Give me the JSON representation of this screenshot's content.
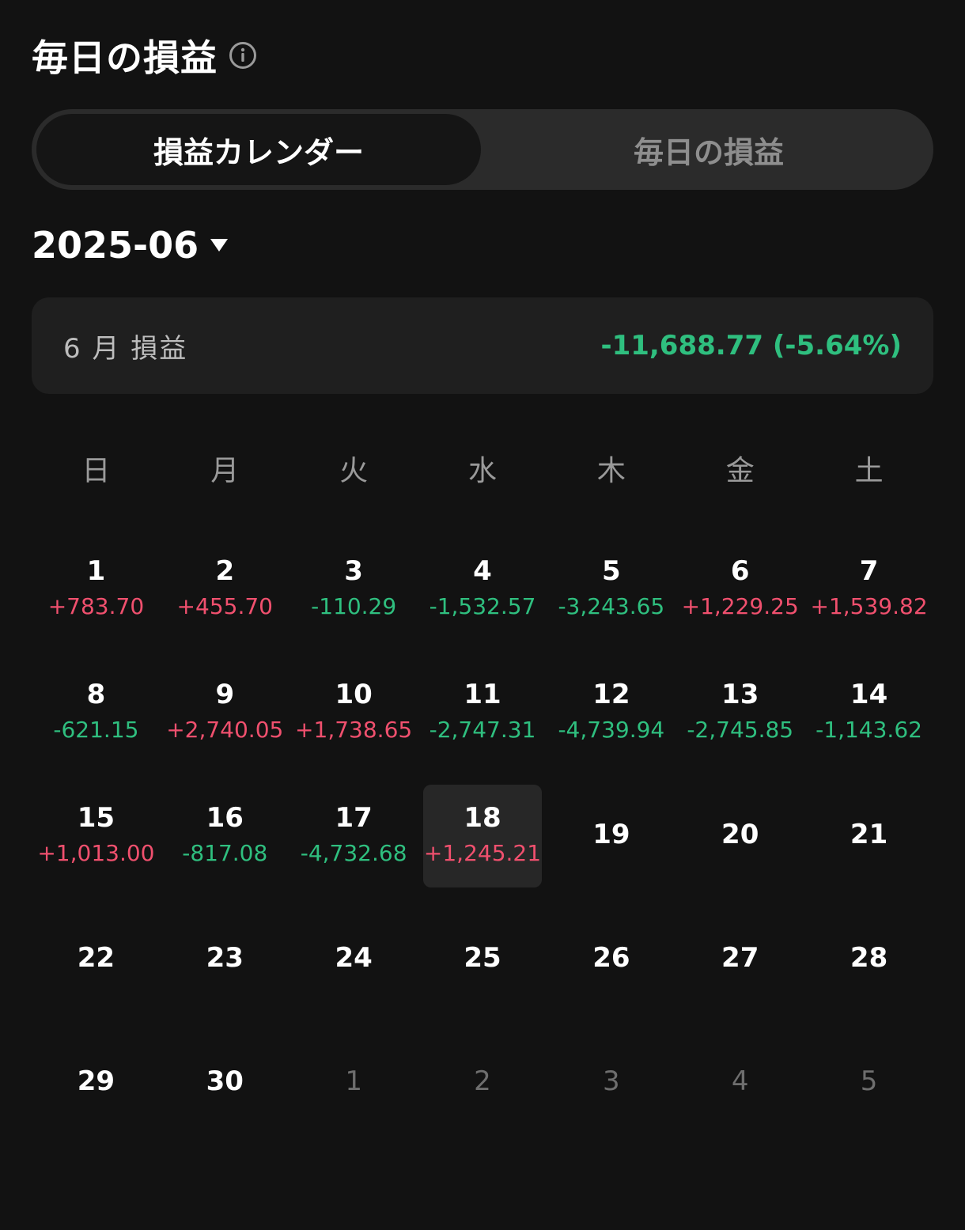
{
  "header": {
    "title": "毎日の損益",
    "info_icon": "info-circle-icon"
  },
  "tabs": [
    {
      "label": "損益カレンダー",
      "active": true
    },
    {
      "label": "毎日の損益",
      "active": false
    }
  ],
  "month_picker": {
    "value": "2025-06",
    "icon": "caret-down-icon"
  },
  "summary": {
    "label": "6 月 損益",
    "value": "-11,688.77 (-5.64%)"
  },
  "colors": {
    "positive": "#f0506e",
    "negative": "#2fbf7f",
    "background": "#121212"
  },
  "weekdays": [
    "日",
    "月",
    "火",
    "水",
    "木",
    "金",
    "土"
  ],
  "days": [
    {
      "day": "1",
      "pl": "+783.70",
      "dir": "pos"
    },
    {
      "day": "2",
      "pl": "+455.70",
      "dir": "pos"
    },
    {
      "day": "3",
      "pl": "-110.29",
      "dir": "neg"
    },
    {
      "day": "4",
      "pl": "-1,532.57",
      "dir": "neg"
    },
    {
      "day": "5",
      "pl": "-3,243.65",
      "dir": "neg"
    },
    {
      "day": "6",
      "pl": "+1,229.25",
      "dir": "pos"
    },
    {
      "day": "7",
      "pl": "+1,539.82",
      "dir": "pos"
    },
    {
      "day": "8",
      "pl": "-621.15",
      "dir": "neg"
    },
    {
      "day": "9",
      "pl": "+2,740.05",
      "dir": "pos"
    },
    {
      "day": "10",
      "pl": "+1,738.65",
      "dir": "pos"
    },
    {
      "day": "11",
      "pl": "-2,747.31",
      "dir": "neg"
    },
    {
      "day": "12",
      "pl": "-4,739.94",
      "dir": "neg"
    },
    {
      "day": "13",
      "pl": "-2,745.85",
      "dir": "neg"
    },
    {
      "day": "14",
      "pl": "-1,143.62",
      "dir": "neg"
    },
    {
      "day": "15",
      "pl": "+1,013.00",
      "dir": "pos"
    },
    {
      "day": "16",
      "pl": "-817.08",
      "dir": "neg"
    },
    {
      "day": "17",
      "pl": "-4,732.68",
      "dir": "neg"
    },
    {
      "day": "18",
      "pl": "+1,245.21",
      "dir": "pos",
      "selected": true
    },
    {
      "day": "19"
    },
    {
      "day": "20"
    },
    {
      "day": "21"
    },
    {
      "day": "22"
    },
    {
      "day": "23"
    },
    {
      "day": "24"
    },
    {
      "day": "25"
    },
    {
      "day": "26"
    },
    {
      "day": "27"
    },
    {
      "day": "28"
    },
    {
      "day": "29"
    },
    {
      "day": "30"
    },
    {
      "day": "1",
      "other": true
    },
    {
      "day": "2",
      "other": true
    },
    {
      "day": "3",
      "other": true
    },
    {
      "day": "4",
      "other": true
    },
    {
      "day": "5",
      "other": true
    }
  ]
}
